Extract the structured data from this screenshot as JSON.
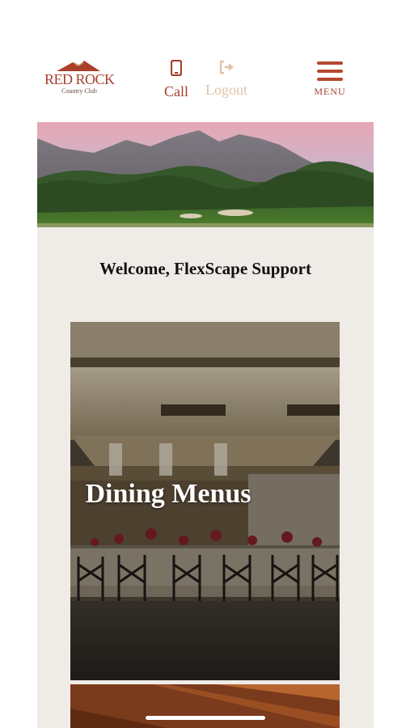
{
  "header": {
    "logo_name": "RED ROCK",
    "logo_sub": "Country Club",
    "call_label": "Call",
    "logout_label": "Logout",
    "menu_label": "MENU"
  },
  "welcome_text": "Welcome, FlexScape Support",
  "cards": [
    {
      "title": "Dining Menus"
    }
  ],
  "icons": [
    "phone-icon",
    "logout-icon",
    "hamburger-menu-icon"
  ],
  "colors": {
    "brand_red": "#a8402c",
    "menu_red": "#b5482f",
    "logout_faded": "#e0c4a8",
    "page_bg": "#efebe7"
  }
}
